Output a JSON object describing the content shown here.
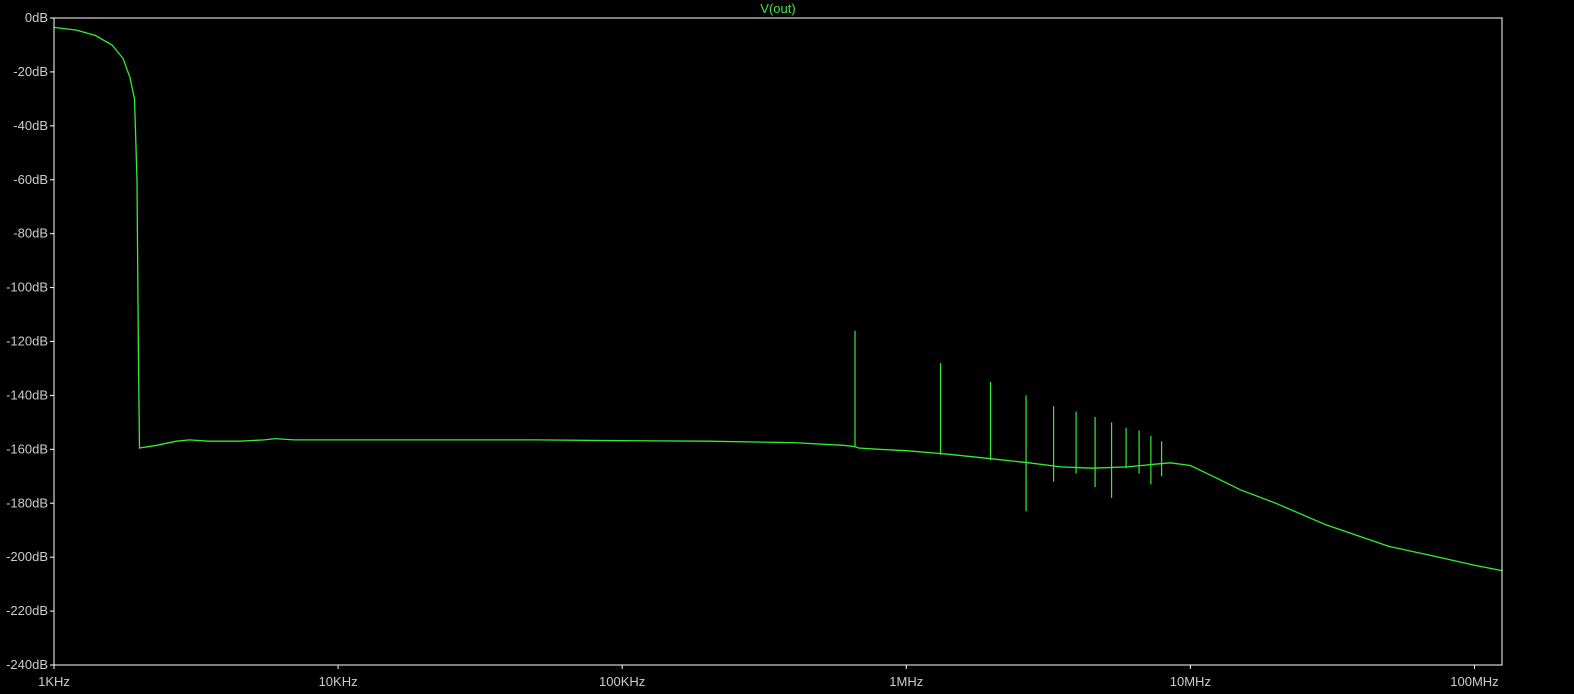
{
  "colors": {
    "background": "#000000",
    "frame": "#ffffff",
    "tick_label": "#cccccc",
    "trace": "#33ee33",
    "title": "#4be04b"
  },
  "chart_data": {
    "type": "line",
    "title": "V(out)",
    "xlabel": "",
    "ylabel": "",
    "x_scale": "log",
    "xlim": [
      1000,
      125000000
    ],
    "ylim": [
      -240,
      0
    ],
    "grid": false,
    "x_ticks": [
      {
        "value": 1000,
        "label": "1KHz"
      },
      {
        "value": 10000,
        "label": "10KHz"
      },
      {
        "value": 100000,
        "label": "100KHz"
      },
      {
        "value": 1000000,
        "label": "1MHz"
      },
      {
        "value": 10000000,
        "label": "10MHz"
      },
      {
        "value": 100000000,
        "label": "100MHz"
      }
    ],
    "y_ticks": [
      {
        "value": 0,
        "label": "0dB"
      },
      {
        "value": -20,
        "label": "-20dB"
      },
      {
        "value": -40,
        "label": "-40dB"
      },
      {
        "value": -60,
        "label": "-60dB"
      },
      {
        "value": -80,
        "label": "-80dB"
      },
      {
        "value": -100,
        "label": "-100dB"
      },
      {
        "value": -120,
        "label": "-120dB"
      },
      {
        "value": -140,
        "label": "-140dB"
      },
      {
        "value": -160,
        "label": "-160dB"
      },
      {
        "value": -180,
        "label": "-180dB"
      },
      {
        "value": -200,
        "label": "-200dB"
      },
      {
        "value": -220,
        "label": "-220dB"
      },
      {
        "value": -240,
        "label": "-240dB"
      }
    ],
    "series": [
      {
        "name": "V(out)",
        "x": [
          1000,
          1200,
          1400,
          1600,
          1750,
          1850,
          1920,
          1960,
          1980,
          1995,
          2000,
          2300,
          2700,
          3000,
          3500,
          4500,
          5500,
          6000,
          7000,
          8500,
          10000,
          20000,
          50000,
          100000,
          200000,
          400000,
          600000,
          660000,
          680000,
          800000,
          1000000,
          1300000,
          1400000,
          2000000,
          2700000,
          3500000,
          4500000,
          6000000,
          7500000,
          8500000,
          10000000,
          12000000,
          15000000,
          20000000,
          30000000,
          50000000,
          75000000,
          100000000,
          125000000
        ],
        "y": [
          -3.5,
          -4.5,
          -6.5,
          -10,
          -15,
          -22,
          -30,
          -60,
          -120,
          -150,
          -159.5,
          -158.5,
          -157,
          -156.5,
          -157,
          -157,
          -156.5,
          -156,
          -156.5,
          -156.5,
          -156.5,
          -156.5,
          -156.5,
          -156.8,
          -157,
          -157.5,
          -158.5,
          -159,
          -159.5,
          -160,
          -160.5,
          -161.5,
          -161.8,
          -163.5,
          -165,
          -166.5,
          -167,
          -166.5,
          -165.5,
          -165,
          -166,
          -170,
          -175,
          -180,
          -188,
          -196,
          -200,
          -203,
          -205
        ]
      }
    ],
    "spikes": {
      "x": [
        660000,
        1320000,
        1980000,
        2640000,
        3300000,
        3960000,
        4620000,
        5280000,
        5940000,
        6600000,
        7260000,
        7920000
      ],
      "top": [
        -116,
        -128,
        -135,
        -140,
        -144,
        -146,
        -148,
        -150,
        -152,
        -153,
        -155,
        -157
      ],
      "bottom": [
        -159,
        -162,
        -164,
        -183,
        -172,
        -169,
        -174,
        -178,
        -167,
        -169,
        -173,
        -170
      ]
    }
  }
}
